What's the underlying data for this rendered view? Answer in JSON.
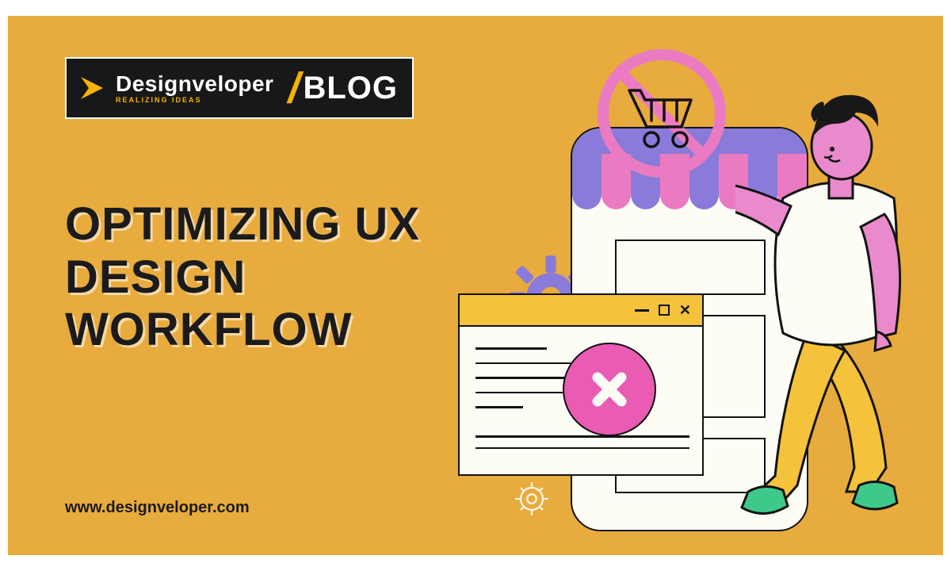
{
  "logo": {
    "brand": "Designveloper",
    "tagline": "REALIZING IDEAS",
    "slash": "/",
    "blog": "BLOG"
  },
  "title": {
    "line1": "OPTIMIZING UX",
    "line2": "DESIGN",
    "line3": "WORKFLOW"
  },
  "url": "www.designveloper.com",
  "colors": {
    "background": "#e8ab3d",
    "dark": "#181818",
    "accent_purple": "#8a7ad9",
    "accent_pink": "#ea7bc2",
    "accent_green": "#3ec98b",
    "accent_yellow": "#f4c23b"
  },
  "icons": {
    "no_cart": "no-cart-icon",
    "gear": "gear-icon",
    "error_x": "error-x-icon",
    "window_min": "window-minimize-icon",
    "window_max": "window-maximize-icon",
    "window_close": "window-close-icon",
    "logo_arrow": "logo-arrow-icon"
  }
}
